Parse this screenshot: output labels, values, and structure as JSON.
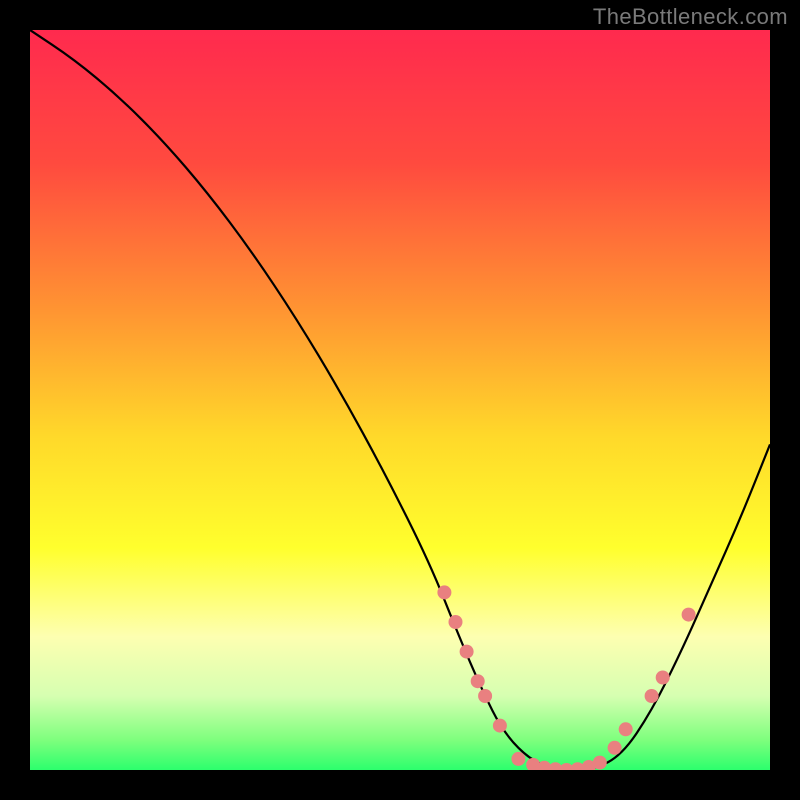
{
  "watermark": "TheBottleneck.com",
  "colors": {
    "background": "#000000",
    "watermark_text": "#7a7a7a",
    "curve_stroke": "#000000",
    "marker_fill": "#e98080",
    "gradient_stops": [
      {
        "offset": 0.0,
        "color": "#ff2a4e"
      },
      {
        "offset": 0.18,
        "color": "#ff4a3f"
      },
      {
        "offset": 0.38,
        "color": "#ff9532"
      },
      {
        "offset": 0.55,
        "color": "#ffd92a"
      },
      {
        "offset": 0.7,
        "color": "#ffff2d"
      },
      {
        "offset": 0.82,
        "color": "#fdffb1"
      },
      {
        "offset": 0.9,
        "color": "#d6ffb1"
      },
      {
        "offset": 0.96,
        "color": "#7dff7d"
      },
      {
        "offset": 1.0,
        "color": "#2cff6d"
      }
    ]
  },
  "chart_data": {
    "type": "line",
    "title": "",
    "xlabel": "",
    "ylabel": "",
    "xlim": [
      0,
      100
    ],
    "ylim": [
      0,
      100
    ],
    "grid": false,
    "series": [
      {
        "name": "bottleneck-curve",
        "x": [
          0,
          6,
          12,
          18,
          24,
          30,
          36,
          42,
          48,
          54,
          58,
          61,
          64,
          68,
          72,
          76,
          80,
          84,
          88,
          92,
          96,
          100
        ],
        "y": [
          100,
          96,
          91,
          85,
          78,
          70,
          61,
          51,
          40,
          28,
          18,
          11,
          5,
          1,
          0,
          0,
          2,
          8,
          16,
          25,
          34,
          44
        ]
      }
    ],
    "markers": [
      {
        "name": "marker-left-1",
        "x": 56.0,
        "y": 24.0
      },
      {
        "name": "marker-left-2",
        "x": 57.5,
        "y": 20.0
      },
      {
        "name": "marker-left-3",
        "x": 59.0,
        "y": 16.0
      },
      {
        "name": "marker-left-4",
        "x": 60.5,
        "y": 12.0
      },
      {
        "name": "marker-left-5",
        "x": 61.5,
        "y": 10.0
      },
      {
        "name": "marker-left-6",
        "x": 63.5,
        "y": 6.0
      },
      {
        "name": "marker-flat-1",
        "x": 66.0,
        "y": 1.5
      },
      {
        "name": "marker-flat-2",
        "x": 68.0,
        "y": 0.7
      },
      {
        "name": "marker-flat-3",
        "x": 69.5,
        "y": 0.3
      },
      {
        "name": "marker-flat-4",
        "x": 71.0,
        "y": 0.1
      },
      {
        "name": "marker-flat-5",
        "x": 72.5,
        "y": 0.0
      },
      {
        "name": "marker-flat-6",
        "x": 74.0,
        "y": 0.1
      },
      {
        "name": "marker-flat-7",
        "x": 75.5,
        "y": 0.4
      },
      {
        "name": "marker-flat-8",
        "x": 77.0,
        "y": 1.0
      },
      {
        "name": "marker-right-1",
        "x": 79.0,
        "y": 3.0
      },
      {
        "name": "marker-right-2",
        "x": 80.5,
        "y": 5.5
      },
      {
        "name": "marker-right-3",
        "x": 84.0,
        "y": 10.0
      },
      {
        "name": "marker-right-4",
        "x": 85.5,
        "y": 12.5
      },
      {
        "name": "marker-right-5",
        "x": 89.0,
        "y": 21.0
      }
    ]
  }
}
